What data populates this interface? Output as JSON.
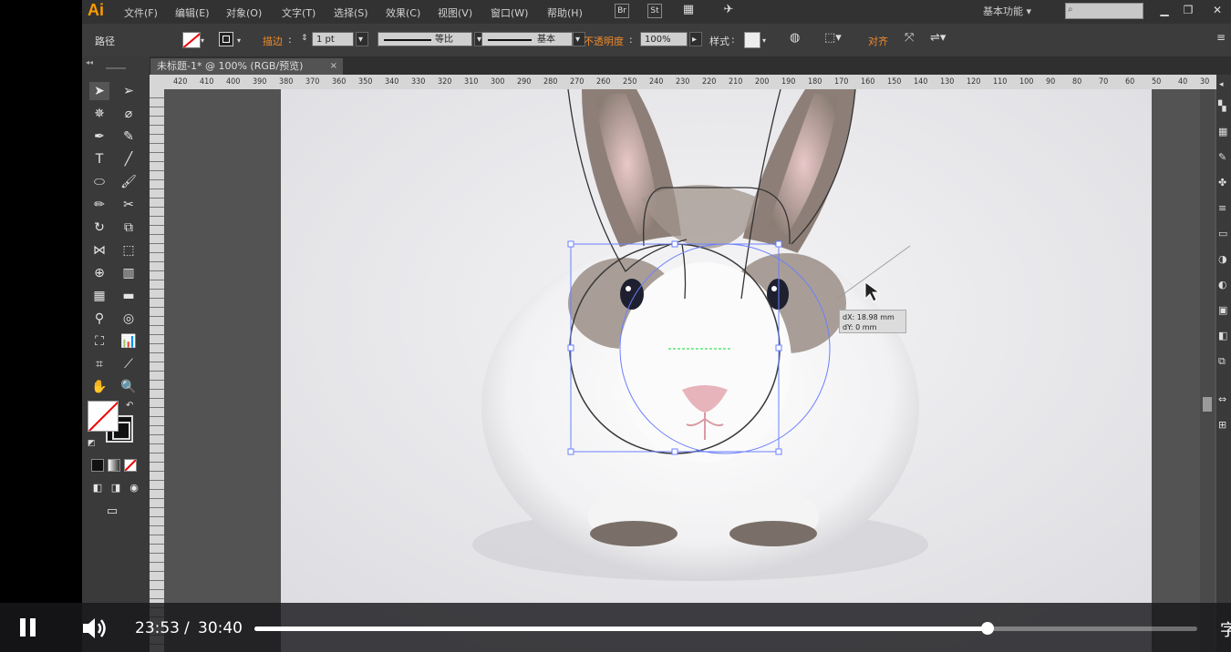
{
  "app": {
    "logo": "Ai",
    "menus": [
      "文件(F)",
      "编辑(E)",
      "对象(O)",
      "文字(T)",
      "选择(S)",
      "效果(C)",
      "视图(V)",
      "窗口(W)",
      "帮助(H)"
    ],
    "bridge_icon": "Br",
    "stock_icon": "St",
    "workspace_label": "基本功能",
    "search_placeholder": ""
  },
  "control_bar": {
    "selection_label": "路径",
    "stroke_label": "描边",
    "stroke_weight": "1 pt",
    "stroke_profile": "等比",
    "brush": "基本",
    "opacity_label": "不透明度",
    "opacity_value": "100%",
    "style_label": "样式",
    "align_label": "对齐"
  },
  "document": {
    "tab_title": "未标题-1* @ 100% (RGB/预览)",
    "close_glyph": "×"
  },
  "ruler": {
    "ticks": [
      "420",
      "410",
      "400",
      "390",
      "380",
      "370",
      "360",
      "350",
      "340",
      "330",
      "320",
      "310",
      "300",
      "290",
      "280",
      "270",
      "260",
      "250",
      "240",
      "230",
      "220",
      "210",
      "200",
      "190",
      "180",
      "170",
      "160",
      "150",
      "140",
      "130",
      "120",
      "110",
      "100",
      "90",
      "80",
      "70",
      "60",
      "50",
      "40",
      "30"
    ]
  },
  "tooltip": {
    "dx": "dX: 18.98 mm",
    "dy": "dY: 0 mm"
  },
  "video": {
    "current_time": "23:53",
    "separator": "/",
    "total_time": "30:40",
    "progress": 0.7775,
    "caption_glyph": "字"
  },
  "colors": {
    "accent_orange": "#f08a2a",
    "selection_blue": "#6b7fff",
    "smart_guide_green": "#3ee05a"
  }
}
